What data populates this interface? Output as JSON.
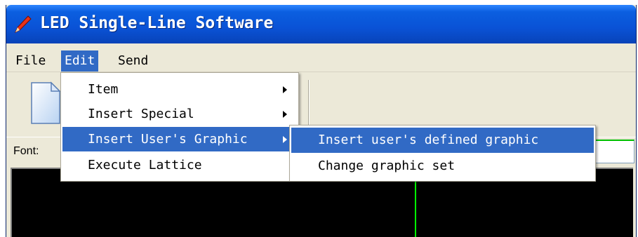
{
  "window": {
    "title": "LED Single-Line Software",
    "title_icon": "pencil-icon"
  },
  "menubar": {
    "items": [
      "File",
      "Edit",
      "Send"
    ],
    "active": "Edit"
  },
  "toolbar": {
    "new_icon": "new-document-icon"
  },
  "font_row": {
    "label": "Font:"
  },
  "edit_menu": {
    "items": [
      {
        "label": "Item",
        "has_submenu": true
      },
      {
        "label": "Insert Special",
        "has_submenu": true
      },
      {
        "label": "Insert User's Graphic",
        "has_submenu": true,
        "highlighted": true
      },
      {
        "label": "Execute Lattice",
        "has_submenu": false
      }
    ]
  },
  "graphic_submenu": {
    "items": [
      {
        "label": "Insert user's defined graphic",
        "highlighted": true
      },
      {
        "label": "Change graphic set"
      }
    ]
  },
  "colors": {
    "titlebar": "#0a52d6",
    "menu_highlight": "#316ac5",
    "canvas": "#000000",
    "indicator_line": "#00ff00"
  }
}
